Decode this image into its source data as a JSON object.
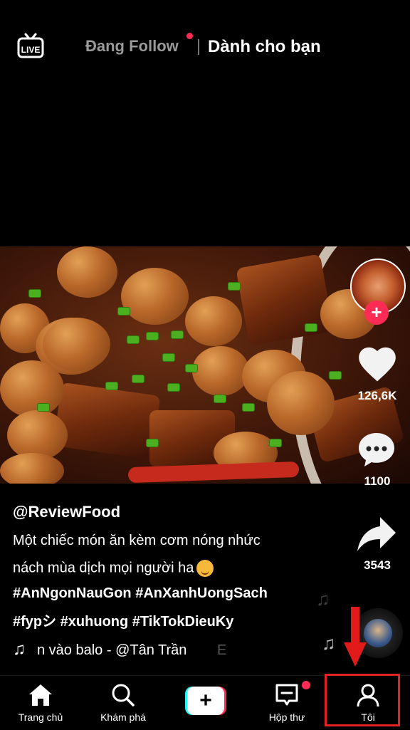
{
  "top_bar": {
    "live_label": "LIVE",
    "tab_following": "Đang Follow",
    "tab_for_you": "Dành cho bạn"
  },
  "video": {
    "author": "@ReviewFood",
    "caption_line1": "Một chiếc món ăn kèm cơm nóng nhức",
    "caption_line2": "nách mùa dịch mọi người ha",
    "hashtags_line1": "#AnNgonNauGon #AnXanhUongSach",
    "hashtags_line2": "#fypシ #xuhuong #TikTokDieuKy",
    "music": "n vào balo - @Tân Trần",
    "music_overflow": "E"
  },
  "actions": {
    "likes": "126,6K",
    "comments": "1100",
    "shares": "3543",
    "follow_plus": "+"
  },
  "nav": {
    "home": "Trang chủ",
    "discover": "Khám phá",
    "create": "+",
    "inbox": "Hộp thư",
    "profile": "Tôi"
  },
  "colors": {
    "accent_red": "#fe2c55",
    "accent_cyan": "#25f4ee",
    "annotation_red": "#e32323"
  },
  "icons": [
    "live-icon",
    "heart-icon",
    "comment-icon",
    "share-icon",
    "music-note-icon",
    "home-icon",
    "search-icon",
    "plus-icon",
    "inbox-icon",
    "profile-icon"
  ]
}
